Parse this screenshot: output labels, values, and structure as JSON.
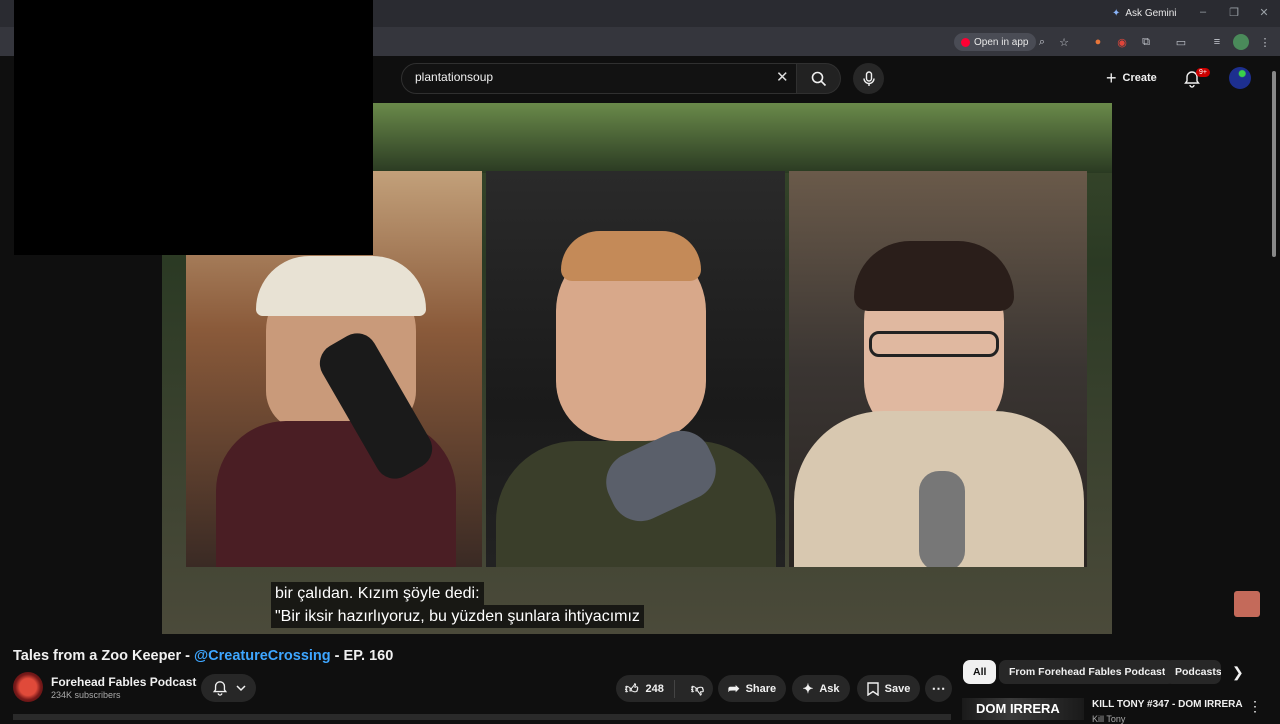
{
  "browser": {
    "ask_gemini": "Ask Gemini",
    "open_in_app": "Open in app"
  },
  "header": {
    "search_value": "plantationsoup",
    "create_label": "Create",
    "notification_badge": "9+"
  },
  "video": {
    "subtitle_line1": "bir çalıdan. Kızım şöyle dedi:",
    "subtitle_line2": "\"Bir iksir hazırlıyoruz, bu yüzden şunlara ihtiyacımız"
  },
  "info": {
    "title_prefix": "Tales from a Zoo Keeper - ",
    "title_mention": "@CreatureCrossing",
    "title_suffix": " - EP. 160",
    "channel_name": "Forehead Fables Podcast",
    "subscribers": "234K subscribers",
    "like_count": "248",
    "share_label": "Share",
    "ask_label": "Ask",
    "save_label": "Save"
  },
  "chips": {
    "all": "All",
    "from_channel": "From Forehead Fables Podcast",
    "podcasts": "Podcasts"
  },
  "recommended": {
    "thumb_text": "DOM IRRERA",
    "title": "KILL TONY #347 - DOM IRRERA",
    "channel": "Kill Tony"
  },
  "colors": {
    "accent_link": "#3ea6ff",
    "badge_red": "#cc0000",
    "background": "#0f0f0f"
  }
}
